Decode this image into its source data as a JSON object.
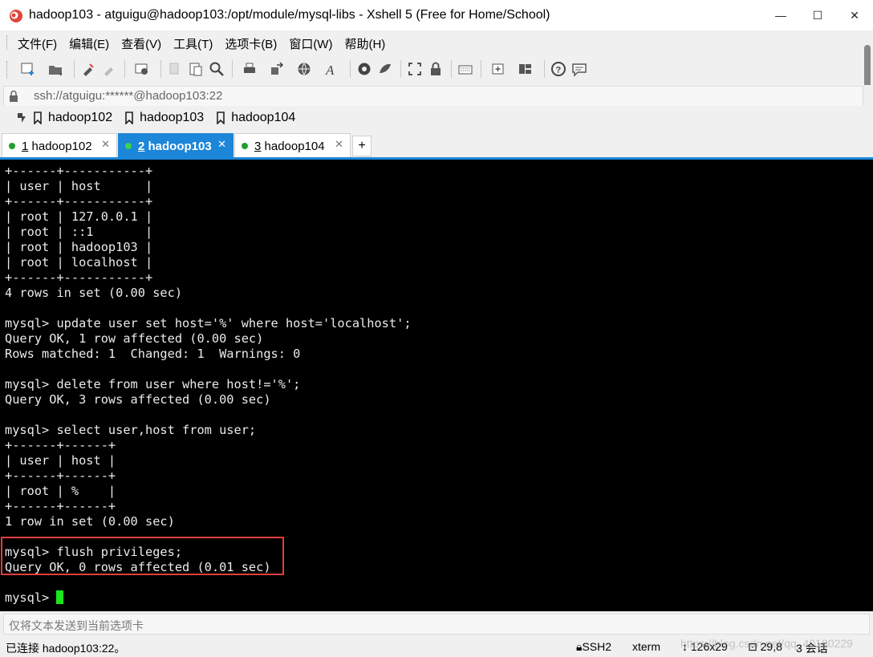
{
  "window": {
    "title": "hadoop103 - atguigu@hadoop103:/opt/module/mysql-libs - Xshell 5 (Free for Home/School)",
    "minimize": "—",
    "maximize": "☐",
    "close": "✕"
  },
  "menu": [
    "文件(F)",
    "编辑(E)",
    "查看(V)",
    "工具(T)",
    "选项卡(B)",
    "窗口(W)",
    "帮助(H)"
  ],
  "toolbar": {
    "icons": [
      "new-session-icon",
      "open-folder-icon",
      "connect-icon",
      "disconnect-icon",
      "properties-icon",
      "copy-icon",
      "paste-icon",
      "find-icon",
      "print-icon",
      "transfer-icon",
      "globe-icon",
      "font-icon",
      "xftp-icon",
      "xmanager-icon",
      "fullscreen-icon",
      "lock-icon",
      "keyboard-icon",
      "new-tab-icon",
      "layout-icon",
      "help-icon",
      "chat-icon"
    ]
  },
  "address": {
    "text": "ssh://atguigu:******@hadoop103:22"
  },
  "links": [
    "hadoop102",
    "hadoop103",
    "hadoop104"
  ],
  "tabs": [
    {
      "num": "1",
      "label": " hadoop102",
      "close": "✕"
    },
    {
      "num": "2",
      "label": " hadoop103",
      "close": "✕"
    },
    {
      "num": "3",
      "label": " hadoop104",
      "close": "✕"
    }
  ],
  "tab_add": "+",
  "terminal": {
    "lines": [
      "+------+-----------+",
      "| user | host      |",
      "+------+-----------+",
      "| root | 127.0.0.1 |",
      "| root | ::1       |",
      "| root | hadoop103 |",
      "| root | localhost |",
      "+------+-----------+",
      "4 rows in set (0.00 sec)",
      "",
      "mysql> update user set host='%' where host='localhost';",
      "Query OK, 1 row affected (0.00 sec)",
      "Rows matched: 1  Changed: 1  Warnings: 0",
      "",
      "mysql> delete from user where host!='%';",
      "Query OK, 3 rows affected (0.00 sec)",
      "",
      "mysql> select user,host from user;",
      "+------+------+",
      "| user | host |",
      "+------+------+",
      "| root | %    |",
      "+------+------+",
      "1 row in set (0.00 sec)",
      "",
      "mysql> flush privileges;",
      "Query OK, 0 rows affected (0.01 sec)",
      "",
      "mysql> "
    ],
    "cursor_color": "#1ce61c"
  },
  "send_bar": {
    "placeholder": "仅将文本发送到当前选项卡"
  },
  "status": {
    "connection": "已连接 hadoop103:22。",
    "protocol": "SSH2",
    "terminal_type": "xterm",
    "size": "126x29",
    "position": "29,8",
    "sessions": "3 会话"
  },
  "watermark": "https://blog.csdn.net/qq_40180229",
  "colors": {
    "accent": "#1c86d8",
    "highlight_box": "#e23d3d",
    "status_dot": "#1e9e2f"
  }
}
